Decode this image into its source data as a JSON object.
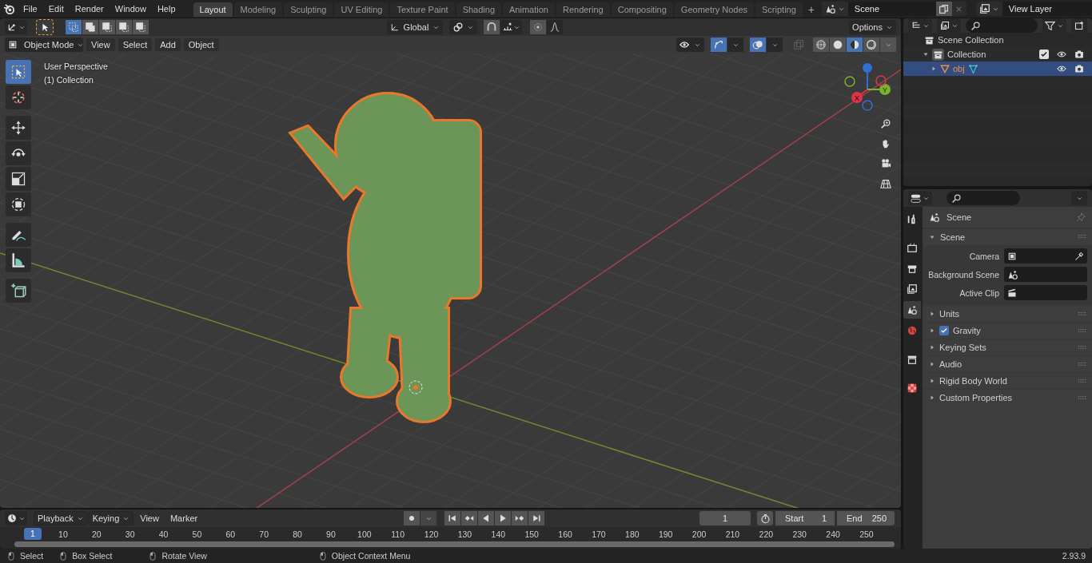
{
  "top_bar": {
    "menus": [
      "File",
      "Edit",
      "Render",
      "Window",
      "Help"
    ],
    "workspace_tabs": [
      {
        "label": "Layout",
        "selected": true
      },
      {
        "label": "Modeling",
        "selected": false
      },
      {
        "label": "Sculpting",
        "selected": false
      },
      {
        "label": "UV Editing",
        "selected": false
      },
      {
        "label": "Texture Paint",
        "selected": false
      },
      {
        "label": "Shading",
        "selected": false
      },
      {
        "label": "Animation",
        "selected": false
      },
      {
        "label": "Rendering",
        "selected": false
      },
      {
        "label": "Compositing",
        "selected": false
      },
      {
        "label": "Geometry Nodes",
        "selected": false
      },
      {
        "label": "Scripting",
        "selected": false
      }
    ],
    "add_tab": "+",
    "scene": "Scene",
    "view_layer": "View Layer"
  },
  "tool_header": {
    "select_modes": [
      {
        "selected": true
      },
      {
        "selected": false
      },
      {
        "selected": false
      },
      {
        "selected": false
      },
      {
        "selected": false
      }
    ],
    "orientation": "Global",
    "options": "Options"
  },
  "viewport_header": {
    "mode": "Object Mode",
    "menus": [
      "View",
      "Select",
      "Add",
      "Object"
    ],
    "shading_modes": [
      {
        "selected": false
      },
      {
        "selected": false
      },
      {
        "selected": true
      },
      {
        "selected": false
      }
    ]
  },
  "viewport": {
    "info": [
      "User Perspective",
      "(1) Collection"
    ],
    "tools": [
      {
        "selected": true
      },
      {
        "selected": false
      },
      {
        "selected": false
      },
      {
        "selected": false
      },
      {
        "selected": false
      },
      {
        "selected": false
      },
      {
        "selected": false
      },
      {
        "selected": false
      },
      {
        "selected": false
      }
    ],
    "gizmo_labels": [
      "X",
      "Y"
    ]
  },
  "outliner": {
    "tree": [
      {
        "label": "Scene Collection",
        "selected": false,
        "children": [
          {
            "label": "Collection",
            "selected": false,
            "expanded": true,
            "checked": true,
            "children": [
              {
                "label": "obj",
                "selected": true,
                "expanded": false
              }
            ]
          }
        ]
      }
    ]
  },
  "properties": {
    "tabs": [
      {
        "selected": false
      },
      {
        "selected": false
      },
      {
        "selected": false
      },
      {
        "selected": false
      },
      {
        "selected": true
      },
      {
        "selected": false
      },
      {
        "selected": false
      },
      {
        "selected": false
      }
    ],
    "context": "Scene",
    "panel": {
      "title": "Scene",
      "expanded": true,
      "fields": [
        {
          "label": "Camera"
        },
        {
          "label": "Background Scene"
        },
        {
          "label": "Active Clip"
        }
      ]
    },
    "subpanels": [
      {
        "label": "Units",
        "kind": "plain"
      },
      {
        "label": "Gravity",
        "kind": "checkbox",
        "checked": true
      },
      {
        "label": "Keying Sets",
        "kind": "plain"
      },
      {
        "label": "Audio",
        "kind": "plain"
      },
      {
        "label": "Rigid Body World",
        "kind": "plain"
      },
      {
        "label": "Custom Properties",
        "kind": "plain"
      }
    ]
  },
  "timeline": {
    "menus": [
      "Playback",
      "Keying",
      "View",
      "Marker"
    ],
    "current_frame": "1",
    "start_label": "Start",
    "start": "1",
    "end_label": "End",
    "end": "250",
    "playhead": "1",
    "ruler": [
      "10",
      "20",
      "30",
      "40",
      "50",
      "60",
      "70",
      "80",
      "90",
      "100",
      "110",
      "120",
      "130",
      "140",
      "150",
      "160",
      "170",
      "180",
      "190",
      "200",
      "210",
      "220",
      "230",
      "240",
      "250"
    ]
  },
  "status_bar": {
    "hints": [
      "Select",
      "Box Select",
      "Rotate View",
      "Object Context Menu"
    ],
    "version": "2.93.9"
  }
}
